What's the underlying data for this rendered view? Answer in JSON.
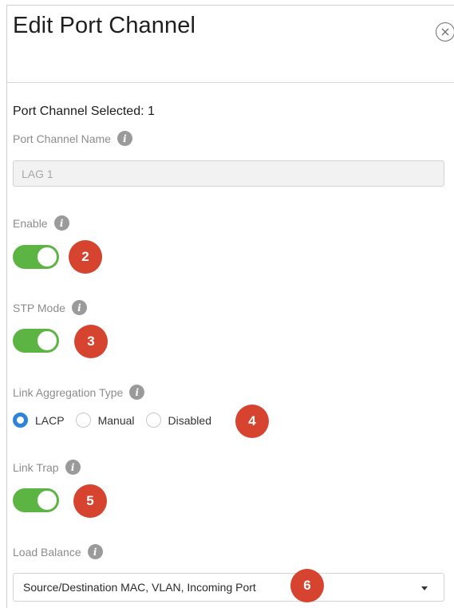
{
  "dialog": {
    "title": "Edit Port Channel",
    "close_icon": "close-circle-icon"
  },
  "selected_text": "Port Channel Selected: 1",
  "port_channel_name": {
    "label": "Port Channel Name",
    "value": "LAG 1",
    "disabled": true
  },
  "enable": {
    "label": "Enable",
    "on": true,
    "callout": "2"
  },
  "stp_mode": {
    "label": "STP Mode",
    "on": true,
    "callout": "3"
  },
  "link_aggregation_type": {
    "label": "Link Aggregation Type",
    "options": [
      "LACP",
      "Manual",
      "Disabled"
    ],
    "selected": "LACP",
    "callout": "4"
  },
  "link_trap": {
    "label": "Link Trap",
    "on": true,
    "callout": "5"
  },
  "load_balance": {
    "label": "Load Balance",
    "selected": "Source/Destination MAC, VLAN, Incoming Port",
    "callout": "6"
  },
  "colors": {
    "toggle_on": "#5cb443",
    "callout": "#d6432f",
    "radio_checked": "#2f83d8"
  }
}
